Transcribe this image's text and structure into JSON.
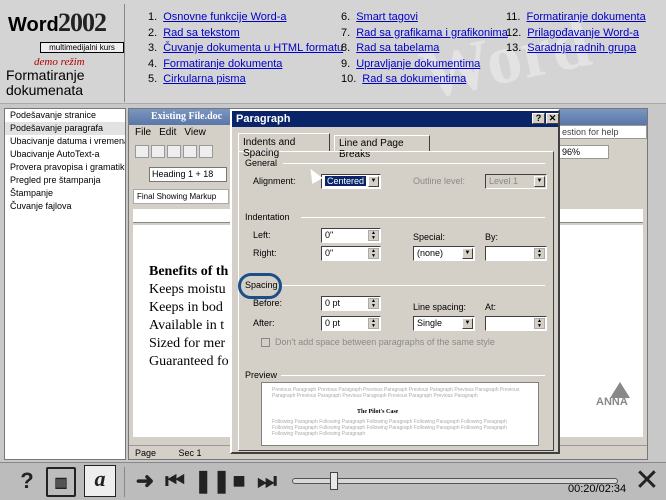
{
  "header": {
    "logo_word": "Word",
    "logo_year": "2002",
    "logo_sub": "multimedijalni kurs",
    "demo_label": "demo režim",
    "section_title": "Formatiranje dokumenata",
    "menu": [
      [
        {
          "num": "1.",
          "label": "Osnovne funkcije Word-a"
        },
        {
          "num": "2.",
          "label": "Rad sa tekstom"
        },
        {
          "num": "3.",
          "label": "Čuvanje dokumenta u HTML formatu"
        },
        {
          "num": "4.",
          "label": "Formatiranje dokumenta"
        },
        {
          "num": "5.",
          "label": "Cirkularna pisma"
        }
      ],
      [
        {
          "num": "6.",
          "label": "Smart tagovi"
        },
        {
          "num": "7.",
          "label": "Rad sa grafikama i grafikonima"
        },
        {
          "num": "8.",
          "label": "Rad sa tabelama"
        },
        {
          "num": "9.",
          "label": "Upravljanje dokumentima"
        },
        {
          "num": "10.",
          "label": "Rad sa dokumentima"
        }
      ],
      [
        {
          "num": "11.",
          "label": "Formatiranje dokumenta"
        },
        {
          "num": "12.",
          "label": "Prilagođavanje Word-a"
        },
        {
          "num": "13.",
          "label": "Saradnja radnih grupa"
        }
      ]
    ]
  },
  "sidebar": {
    "items": [
      "Podešavanje stranice",
      "Podešavanje paragrafa",
      "Ubacivanje datuma i vremena",
      "Ubacivanje AutoText-a",
      "Provera pravopisa i gramatike",
      "Pregled pre štampanja",
      "Štampanje",
      "Čuvanje fajlova"
    ],
    "active_index": 1
  },
  "word": {
    "title": "Existing File.doc",
    "menu": [
      "File",
      "Edit",
      "View"
    ],
    "style": "Heading 1 + 18",
    "markup": "Final Showing Markup",
    "help_placeholder": "estion for help",
    "zoom": "96%",
    "status_page": "Page",
    "status_sec": "Sec 1",
    "doc_lines": [
      "Benefits of th",
      "Keeps moistu",
      "Keeps in bod",
      "Available in t",
      "Sized for mer",
      "Guaranteed fo"
    ]
  },
  "dialog": {
    "title": "Paragraph",
    "help": "?",
    "close": "✕",
    "tab_indents": "Indents and Spacing",
    "tab_breaks": "Line and Page Breaks",
    "general_label": "General",
    "alignment_label": "Alignment:",
    "alignment_value": "Centered",
    "outline_label": "Outline level:",
    "outline_value": "Level 1",
    "indentation_label": "Indentation",
    "left_label": "Left:",
    "left_value": "0\"",
    "right_label": "Right:",
    "right_value": "0\"",
    "special_label": "Special:",
    "special_value": "(none)",
    "by_label": "By:",
    "spacing_label": "Spacing",
    "before_label": "Before:",
    "before_value": "0 pt",
    "after_label": "After:",
    "after_value": "0 pt",
    "line_spacing_label": "Line spacing:",
    "line_spacing_value": "Single",
    "at_label": "At:",
    "dont_add_label": "Don't add space between paragraphs of the same style",
    "preview_label": "Preview",
    "preview_text": "Previous Paragraph Previous Paragraph Previous Paragraph Previous Paragraph Previous Paragraph Previous Paragraph Previous Paragraph Previous Paragraph Previous Paragraph Previous Paragraph",
    "preview_sample": "The Pilot's Case",
    "preview_following": "Following Paragraph Following Paragraph Following Paragraph Following Paragraph Following Paragraph Following Paragraph Following Paragraph Following Paragraph Following Paragraph Following Paragraph Following Paragraph Following Paragraph"
  },
  "player": {
    "help": "?",
    "script_a": "a",
    "arrow": "➜",
    "prev": "⏮",
    "pause": "❚❚",
    "stop": "■",
    "next": "⏭",
    "time": "00:20/02:34",
    "progress": 0.13,
    "exit": "✕"
  },
  "corner_logo": "ANNA"
}
